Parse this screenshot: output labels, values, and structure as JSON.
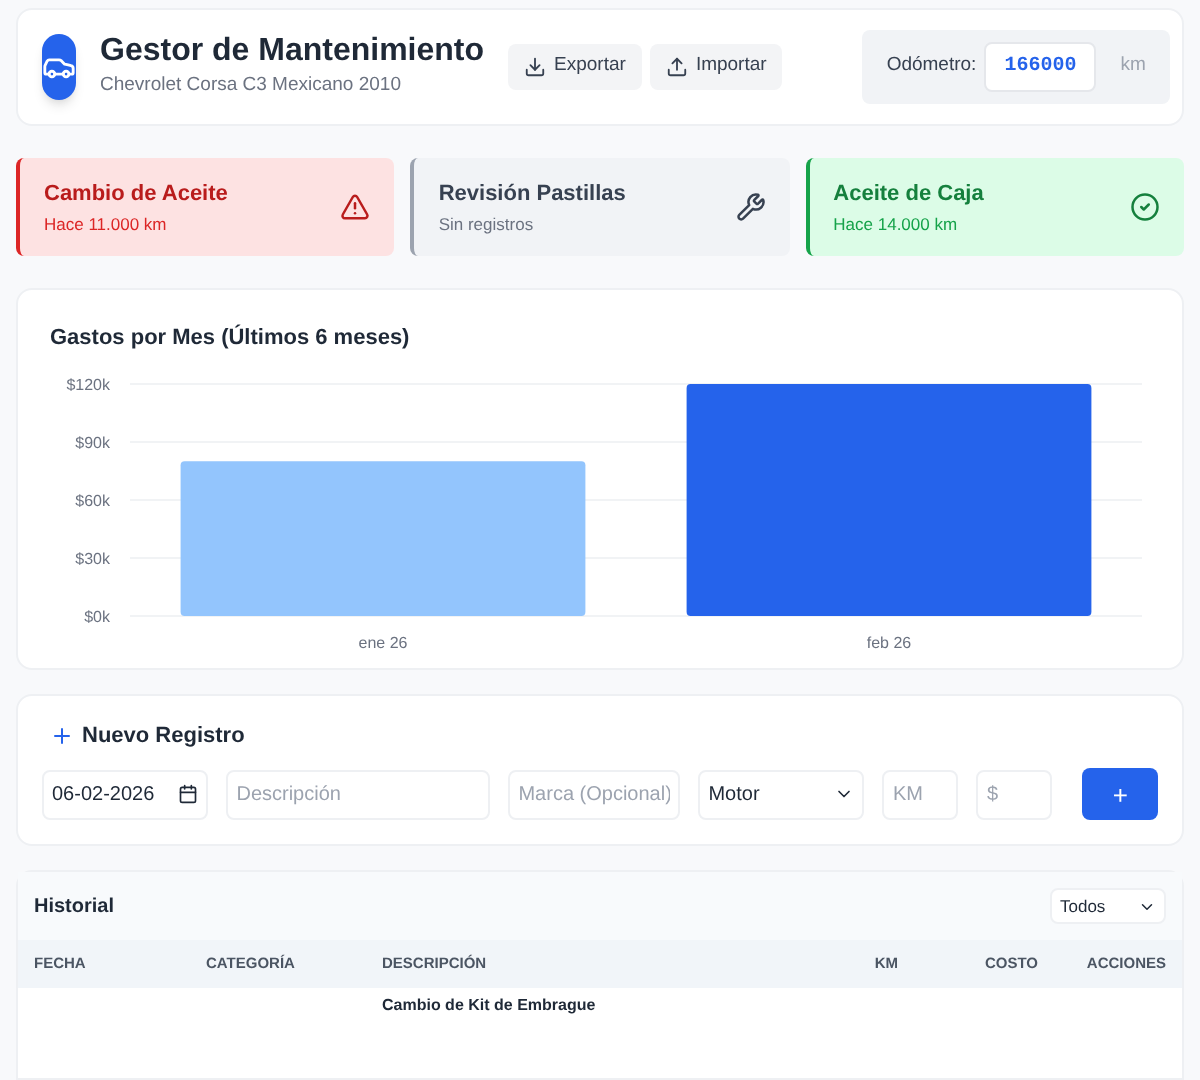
{
  "header": {
    "title": "Gestor de Mantenimiento",
    "subtitle": "Chevrolet Corsa C3 Mexicano 2010",
    "buttons": [
      {
        "kind": "export",
        "label": "Exportar"
      },
      {
        "kind": "import",
        "label": "Importar"
      }
    ],
    "odometer": {
      "label": "Odómetro:",
      "value": "166000",
      "unit": "km"
    }
  },
  "alerts": [
    {
      "kind": "danger",
      "title": "Cambio de Aceite",
      "detail": "Hace 11.000 km"
    },
    {
      "kind": "none",
      "title": "Revisión Pastillas",
      "detail": "Sin registros"
    },
    {
      "kind": "ok",
      "title": "Aceite de Caja",
      "detail": "Hace 14.000 km"
    }
  ],
  "chart": {
    "chart_data": {
      "type": "bar",
      "title": "Gastos por Mes (Últimos 6 meses)",
      "categories": [
        "ene 26",
        "feb 26"
      ],
      "values": [
        80000,
        120000
      ],
      "grid": true,
      "ylim": [
        0,
        120000
      ],
      "yticks": [
        {
          "value": 0,
          "label": "$0k"
        },
        {
          "value": 30000,
          "label": "$30k"
        },
        {
          "value": 60000,
          "label": "$60k"
        },
        {
          "value": 90000,
          "label": "$90k"
        },
        {
          "value": 120000,
          "label": "$120k"
        }
      ]
    }
  },
  "form": {
    "title": "Nuevo Registro",
    "date": "06-02-2026",
    "description_placeholder": "Descripción",
    "brand_placeholder": "Marca (Opcional)",
    "category": "Motor",
    "km_placeholder": "KM",
    "cost_placeholder": "$",
    "submit": "+"
  },
  "history": {
    "title": "Historial",
    "filter": "Todos",
    "columns": [
      "FECHA",
      "CATEGORÍA",
      "DESCRIPCIÓN",
      "KM",
      "COSTO",
      "ACCIONES"
    ],
    "rows": [
      {
        "description": "Cambio de Kit de Embrague"
      }
    ]
  }
}
